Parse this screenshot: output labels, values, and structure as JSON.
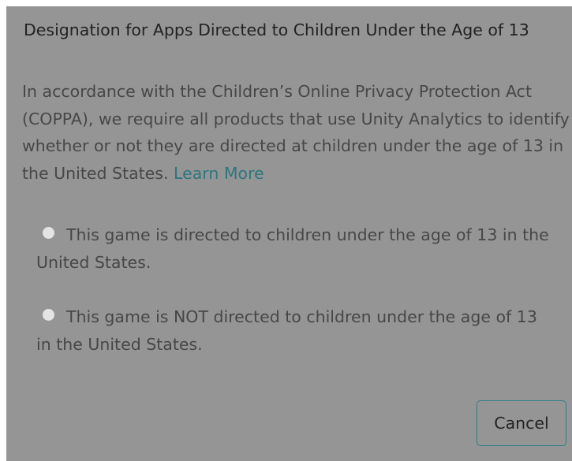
{
  "dialog": {
    "title": "Designation for Apps Directed to Children Under the Age of 13",
    "description": "In accordance with the Children’s Online Privacy Protection Act (COPPA), we require all products that use Unity Analytics to identify whether or not they are directed at children under the age of 13 in the United States.",
    "learn_more_label": "Learn More",
    "options": [
      {
        "label": "This game is directed to children under the age of 13 in the United States.",
        "selected": false
      },
      {
        "label": "This game is NOT directed to children under the age of 13 in the United States.",
        "selected": false
      }
    ],
    "cancel_label": "Cancel"
  },
  "colors": {
    "overlay_background": "#959595",
    "title_text": "#222222",
    "body_text": "#474747",
    "link": "#2d767d",
    "button_border": "#2e7f86",
    "radio_fill": "#e4e4e4"
  }
}
